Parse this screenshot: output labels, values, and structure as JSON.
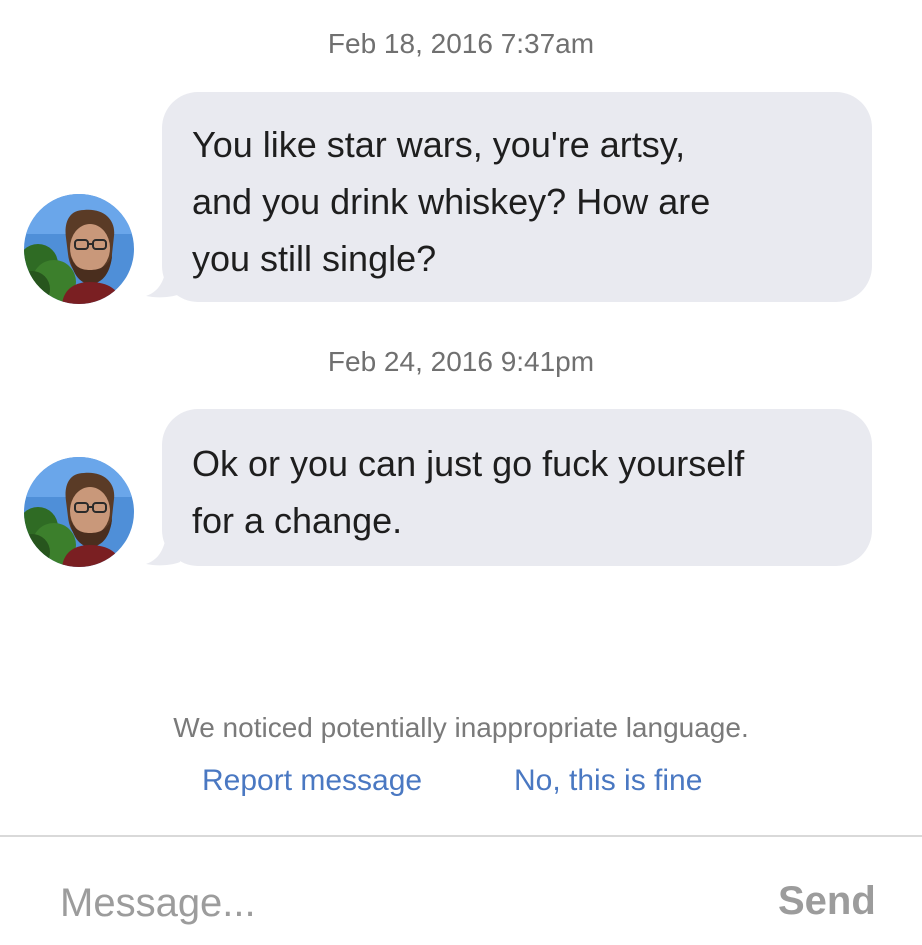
{
  "conversation": {
    "messages": [
      {
        "timestamp": "Feb 18, 2016 7:37am",
        "lines": [
          "You like star wars, you're artsy,",
          "and you drink whiskey? How are",
          "you still single?"
        ]
      },
      {
        "timestamp": "Feb 24, 2016 9:41pm",
        "lines": [
          "Ok or you can just go fuck yourself",
          "for a change."
        ]
      }
    ]
  },
  "moderation": {
    "notice": "We noticed potentially inappropriate language.",
    "report_label": "Report message",
    "dismiss_label": "No, this is fine"
  },
  "composer": {
    "placeholder": "Message...",
    "send_label": "Send"
  },
  "colors": {
    "bubble": "#e9eaf0",
    "link": "#4a78c2",
    "muted": "#9c9c9c"
  }
}
